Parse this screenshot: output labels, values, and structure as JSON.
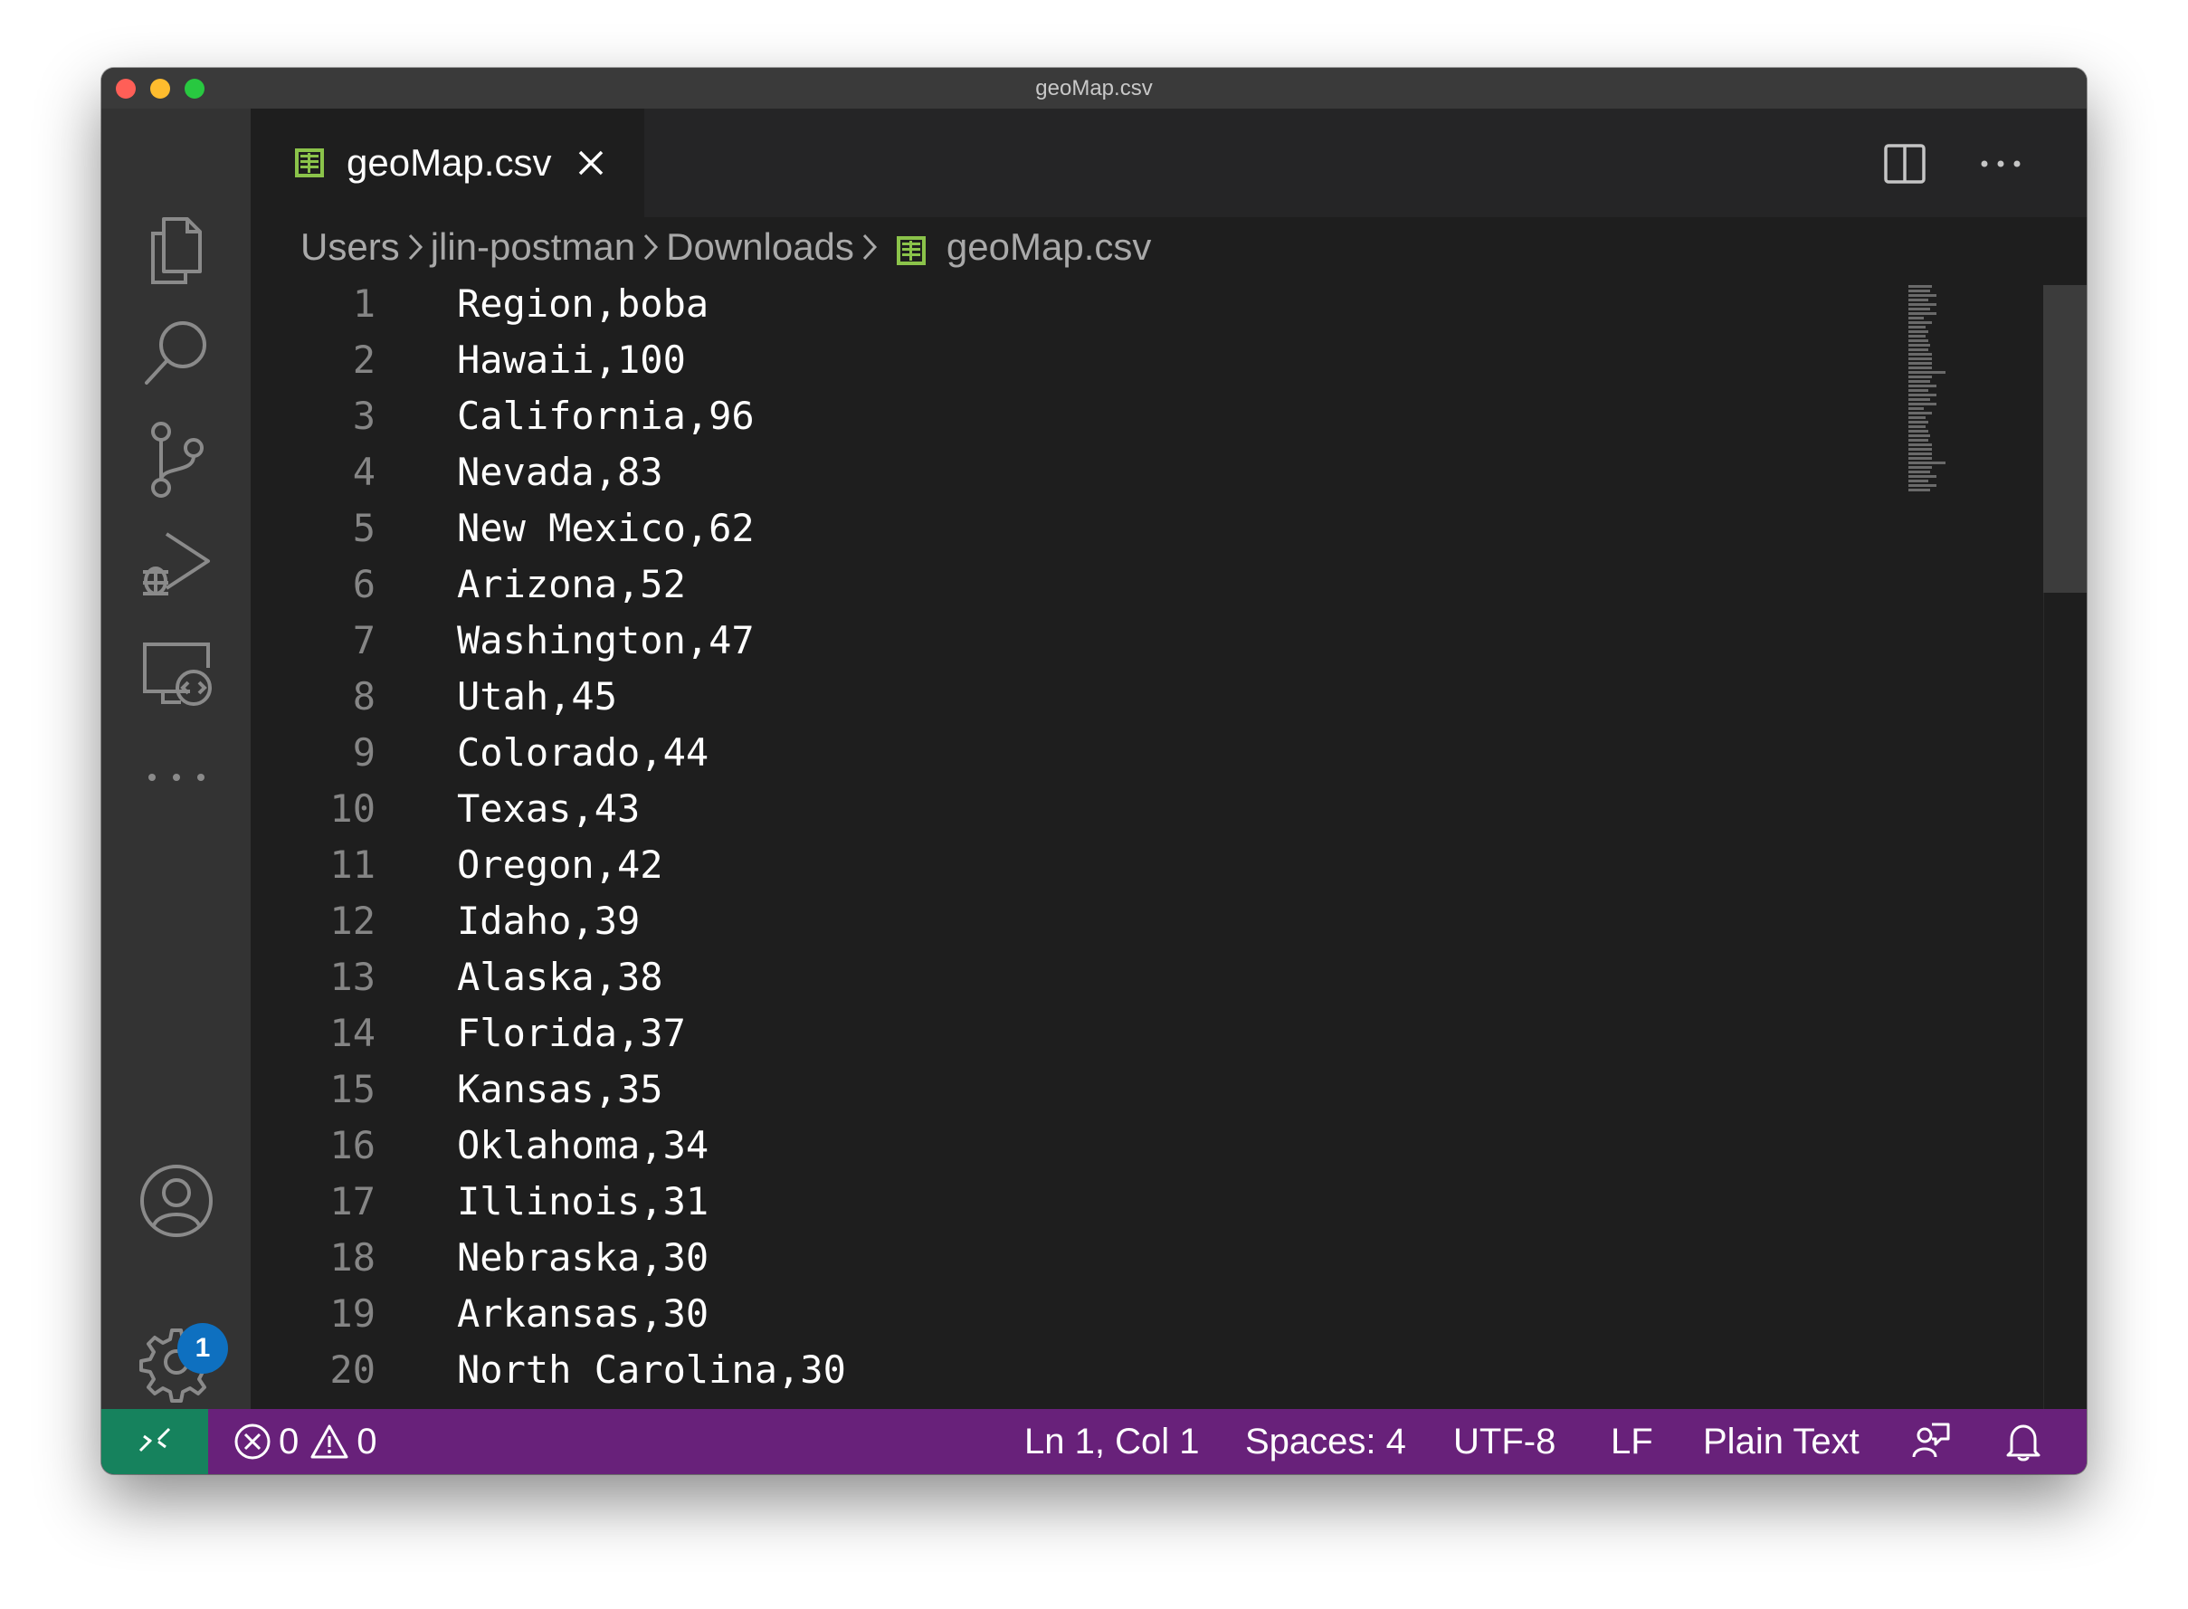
{
  "window": {
    "title": "geoMap.csv"
  },
  "tab": {
    "label": "geoMap.csv",
    "icon": "csv-file-icon"
  },
  "breadcrumb": [
    "Users",
    "jlin-postman",
    "Downloads",
    "geoMap.csv"
  ],
  "editor": {
    "lines": [
      {
        "n": "1",
        "text": "Region,boba"
      },
      {
        "n": "2",
        "text": "Hawaii,100"
      },
      {
        "n": "3",
        "text": "California,96"
      },
      {
        "n": "4",
        "text": "Nevada,83"
      },
      {
        "n": "5",
        "text": "New Mexico,62"
      },
      {
        "n": "6",
        "text": "Arizona,52"
      },
      {
        "n": "7",
        "text": "Washington,47"
      },
      {
        "n": "8",
        "text": "Utah,45"
      },
      {
        "n": "9",
        "text": "Colorado,44"
      },
      {
        "n": "10",
        "text": "Texas,43"
      },
      {
        "n": "11",
        "text": "Oregon,42"
      },
      {
        "n": "12",
        "text": "Idaho,39"
      },
      {
        "n": "13",
        "text": "Alaska,38"
      },
      {
        "n": "14",
        "text": "Florida,37"
      },
      {
        "n": "15",
        "text": "Kansas,35"
      },
      {
        "n": "16",
        "text": "Oklahoma,34"
      },
      {
        "n": "17",
        "text": "Illinois,31"
      },
      {
        "n": "18",
        "text": "Nebraska,30"
      },
      {
        "n": "19",
        "text": "Arkansas,30"
      },
      {
        "n": "20",
        "text": "North Carolina,30"
      }
    ]
  },
  "activity_bar": {
    "items": [
      "files-icon",
      "search-icon",
      "source-control-icon",
      "run-debug-icon",
      "remote-explorer-icon",
      "more-icon",
      "account-icon",
      "gear-icon"
    ],
    "settings_badge": "1"
  },
  "status_bar": {
    "errors": "0",
    "warnings": "0",
    "cursor": "Ln 1, Col 1",
    "indent": "Spaces: 4",
    "encoding": "UTF-8",
    "eol": "LF",
    "language": "Plain Text"
  },
  "colors": {
    "status_bar": "#68217a",
    "remote_indicator": "#16825d",
    "badge": "#0e70c0",
    "csv_icon": "#8bc34a"
  }
}
